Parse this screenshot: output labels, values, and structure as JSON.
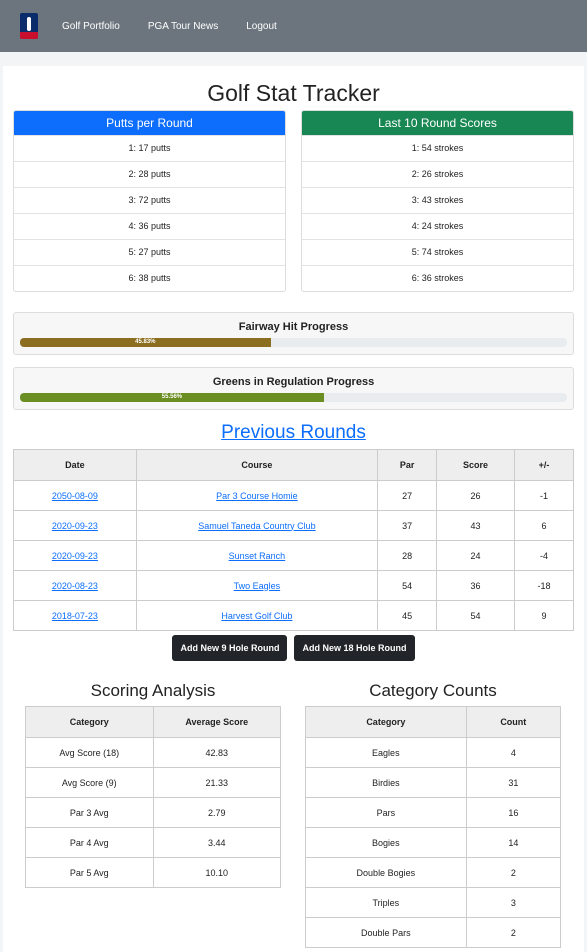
{
  "nav": {
    "links": [
      "Golf Portfolio",
      "PGA Tour News",
      "Logout"
    ]
  },
  "title": "Golf Stat Tracker",
  "putts": {
    "header": "Putts per Round",
    "color": "#0d6efd",
    "rows": [
      "1: 17 putts",
      "2: 28 putts",
      "3: 72 putts",
      "4: 36 putts",
      "5: 27 putts",
      "6: 38 putts"
    ]
  },
  "scores": {
    "header": "Last 10 Round Scores",
    "color": "#198754",
    "rows": [
      "1: 54 strokes",
      "2: 26 strokes",
      "3: 43 strokes",
      "4: 24 strokes",
      "5: 74 strokes",
      "6: 36 strokes"
    ]
  },
  "fairway": {
    "label": "Fairway Hit Progress",
    "percent_text": "45.83%",
    "value": 45.83,
    "color": "#8b6e1f"
  },
  "gir": {
    "label": "Greens in Regulation Progress",
    "percent_text": "55.56%",
    "value": 55.56,
    "color": "#6b8e23"
  },
  "previous_rounds": {
    "title": "Previous Rounds",
    "headers": [
      "Date",
      "Course",
      "Par",
      "Score",
      "+/-"
    ],
    "rows": [
      [
        "2050-08-09",
        "Par 3 Course Homie",
        "27",
        "26",
        "-1"
      ],
      [
        "2020-09-23",
        "Samuel Taneda Country Club",
        "37",
        "43",
        "6"
      ],
      [
        "2020-09-23",
        "Sunset Ranch",
        "28",
        "24",
        "-4"
      ],
      [
        "2020-08-23",
        "Two Eagles",
        "54",
        "36",
        "-18"
      ],
      [
        "2018-07-23",
        "Harvest Golf Club",
        "45",
        "54",
        "9"
      ]
    ]
  },
  "buttons": {
    "nine": "Add New 9 Hole Round",
    "eighteen": "Add New 18 Hole Round"
  },
  "scoring_analysis": {
    "title": "Scoring Analysis",
    "headers": [
      "Category",
      "Average Score"
    ],
    "rows": [
      [
        "Avg Score (18)",
        "42.83"
      ],
      [
        "Avg Score (9)",
        "21.33"
      ],
      [
        "Par 3 Avg",
        "2.79"
      ],
      [
        "Par 4 Avg",
        "3.44"
      ],
      [
        "Par 5 Avg",
        "10.10"
      ]
    ]
  },
  "category_counts": {
    "title": "Category Counts",
    "headers": [
      "Category",
      "Count"
    ],
    "rows": [
      [
        "Eagles",
        "4"
      ],
      [
        "Birdies",
        "31"
      ],
      [
        "Pars",
        "16"
      ],
      [
        "Bogies",
        "14"
      ],
      [
        "Double Bogies",
        "2"
      ],
      [
        "Triples",
        "3"
      ],
      [
        "Double Pars",
        "2"
      ]
    ]
  }
}
